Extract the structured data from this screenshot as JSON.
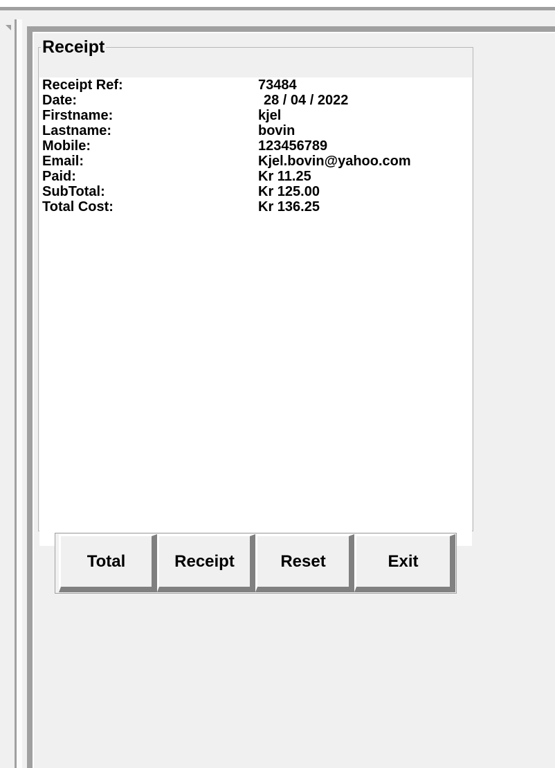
{
  "receipt": {
    "title": "Receipt",
    "rows": [
      {
        "label": "Receipt Ref:",
        "value": "73484"
      },
      {
        "label": "Date:",
        "value": "28 / 04 / 2022"
      },
      {
        "label": "Firstname:",
        "value": "kjel"
      },
      {
        "label": "Lastname:",
        "value": "bovin"
      },
      {
        "label": "Mobile:",
        "value": "123456789"
      },
      {
        "label": "Email:",
        "value": "Kjel.bovin@yahoo.com"
      },
      {
        "label": "Paid:",
        "value": "Kr 11.25"
      },
      {
        "label": "SubTotal:",
        "value": "Kr 125.00"
      },
      {
        "label": "Total Cost:",
        "value": "Kr 136.25"
      }
    ]
  },
  "buttons": {
    "total": "Total",
    "receipt": "Receipt",
    "reset": "Reset",
    "exit": "Exit"
  }
}
